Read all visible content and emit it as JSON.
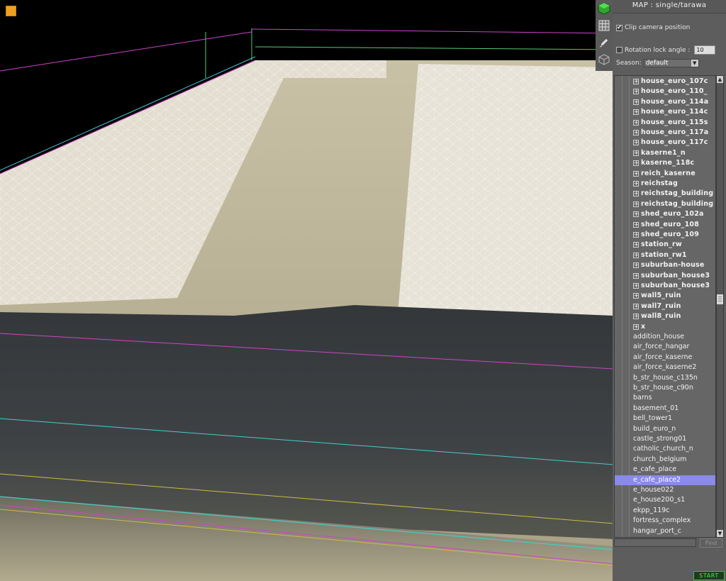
{
  "map": {
    "title": "MAP : single/tarawa"
  },
  "options": {
    "clip_camera": {
      "label": "Clip camera position",
      "checked": true
    },
    "rotation_lock": {
      "label": "Rotation lock angle :",
      "checked": false,
      "value": "10"
    },
    "season": {
      "label": "Season:",
      "value": "default"
    }
  },
  "tools": [
    {
      "icon": "cube-green-icon"
    },
    {
      "icon": "grid-icon"
    },
    {
      "icon": "pencil-icon"
    },
    {
      "icon": "wireframe-cube-icon"
    }
  ],
  "tree": {
    "folders": [
      "house_euro_107c",
      "house_euro_110_",
      "house_euro_114a",
      "house_euro_114c",
      "house_euro_115s",
      "house_euro_117a",
      "house_euro_117c",
      "kaserne1_n",
      "kaserne_118c",
      "reich_kaserne",
      "reichstag",
      "reichstag_building",
      "reichstag_building",
      "shed_euro_102a",
      "shed_euro_108",
      "shed_euro_109",
      "station_rw",
      "station_rw1",
      "suburban-house",
      "suburban_house3",
      "suburban_house3",
      "wall5_ruin",
      "wall7_ruin",
      "wall8_ruin",
      "x"
    ],
    "items": [
      "addition_house",
      "air_force_hangar",
      "air_force_kaserne",
      "air_force_kaserne2",
      "b_str_house_c135n",
      "b_str_house_c90n",
      "barns",
      "basement_01",
      "bell_tower1",
      "build_euro_n",
      "castle_strong01",
      "catholic_church_n",
      "church_belgium",
      "e_cafe_place",
      "e_cafe_place2",
      "e_house022",
      "e_house200_s1",
      "ekpp_119c",
      "fortress_complex",
      "hangar_port_c"
    ],
    "selected": "e_cafe_place2"
  },
  "find": {
    "value": "",
    "button_label": "Find"
  },
  "start": {
    "label": "START"
  },
  "colors": {
    "selection": "#8a8ae8",
    "start_text": "#4fe84f",
    "app_icon": "#f0a020"
  }
}
